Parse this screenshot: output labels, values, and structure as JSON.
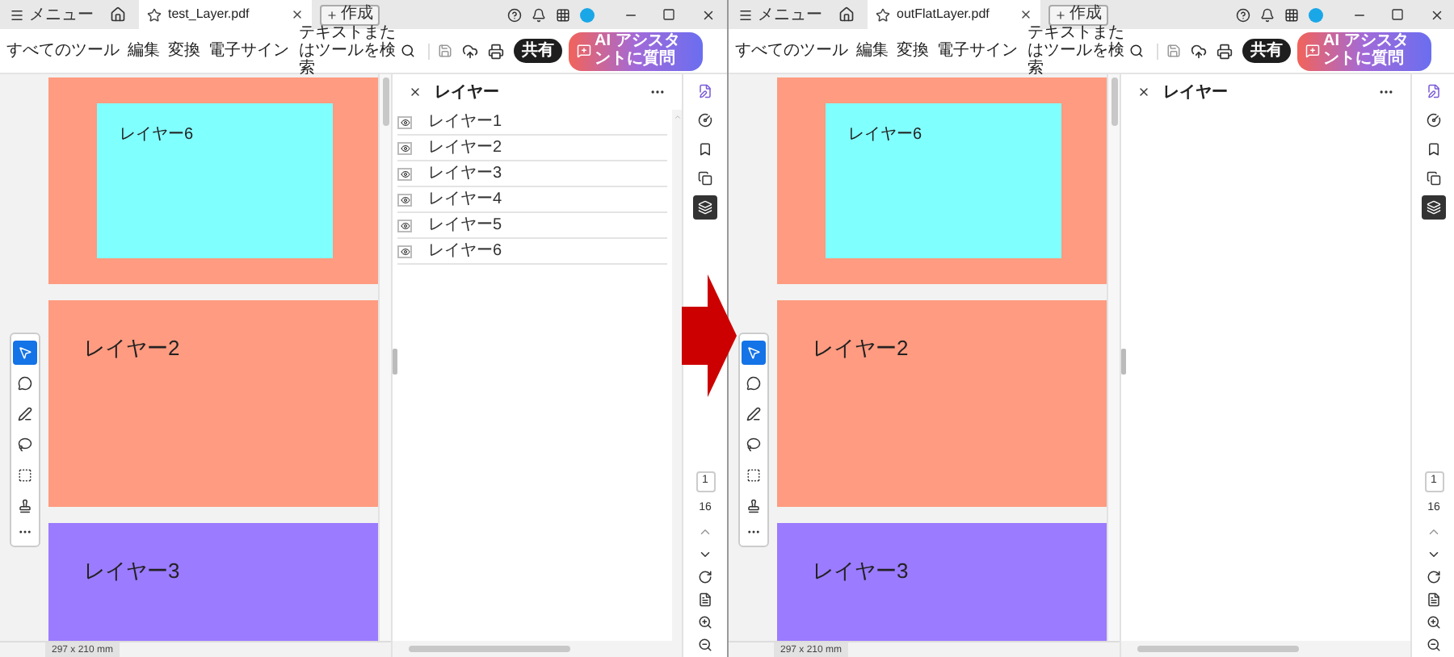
{
  "windows": [
    {
      "menu": "メニュー",
      "tab": "test_Layer.pdf",
      "new_button": "作成",
      "nav": [
        "すべてのツール",
        "編集",
        "変換",
        "電子サイン"
      ],
      "search_label": "テキストまたはツールを検索",
      "share": "共有",
      "ai_button": "AI アシスタントに質問",
      "pages": [
        {
          "color": "#ff9b80",
          "overlay": {
            "color": "#80ffff",
            "label": "レイヤー6"
          }
        },
        {
          "color": "#ff9b80",
          "label": "レイヤー2"
        },
        {
          "color": "#9b7bff",
          "label": "レイヤー3"
        }
      ],
      "page_size": "297 x 210 mm",
      "tools": [
        {
          "selected": true
        },
        {
          "selected": false
        },
        {
          "selected": false
        },
        {
          "selected": false
        },
        {
          "selected": false
        },
        {
          "selected": false
        }
      ],
      "panel": {
        "title": "レイヤー",
        "layers": [
          {
            "name": "レイヤー1"
          },
          {
            "name": "レイヤー2"
          },
          {
            "name": "レイヤー3"
          },
          {
            "name": "レイヤー4"
          },
          {
            "name": "レイヤー5"
          },
          {
            "name": "レイヤー6"
          }
        ]
      },
      "rail": [
        {
          "selected": false
        },
        {
          "selected": false
        },
        {
          "selected": false
        },
        {
          "selected": false
        },
        {
          "selected": true
        }
      ],
      "page_number": "1",
      "page_count": "16"
    },
    {
      "menu": "メニュー",
      "tab": "outFlatLayer.pdf",
      "new_button": "作成",
      "nav": [
        "すべてのツール",
        "編集",
        "変換",
        "電子サイン"
      ],
      "search_label": "テキストまたはツールを検索",
      "share": "共有",
      "ai_button": "AI アシスタントに質問",
      "pages": [
        {
          "color": "#ff9b80",
          "overlay": {
            "color": "#80ffff",
            "label": "レイヤー6"
          }
        },
        {
          "color": "#ff9b80",
          "label": "レイヤー2"
        },
        {
          "color": "#9b7bff",
          "label": "レイヤー3"
        }
      ],
      "page_size": "297 x 210 mm",
      "tools": [
        {
          "selected": true
        },
        {
          "selected": false
        },
        {
          "selected": false
        },
        {
          "selected": false
        },
        {
          "selected": false
        },
        {
          "selected": false
        }
      ],
      "panel": {
        "title": "レイヤー"
      },
      "rail": [
        {
          "selected": false
        },
        {
          "selected": false
        },
        {
          "selected": false
        },
        {
          "selected": false
        },
        {
          "selected": true
        }
      ],
      "page_number": "1",
      "page_count": "16"
    }
  ]
}
